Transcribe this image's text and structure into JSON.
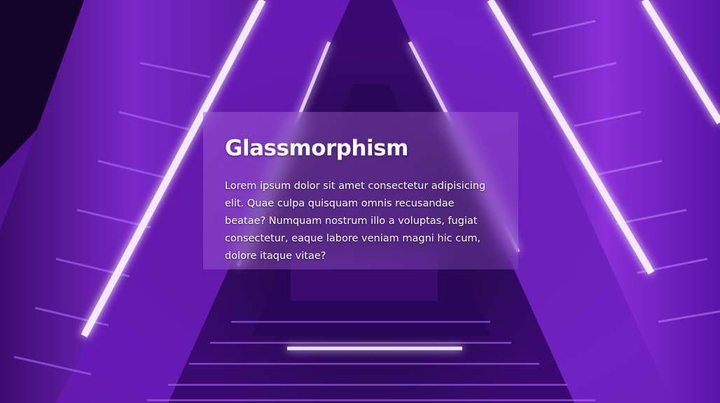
{
  "card": {
    "title": "Glassmorphism",
    "body": "Lorem ipsum dolor sit amet consectetur adipisicing elit. Quae culpa quisquam omnis recusandae beatae? Numquam nostrum illo a voluptas, fugiat consectetur, eaque labore veniam magni hic cum, dolore itaque vitae?"
  },
  "colors": {
    "background_dark": "#1a0630",
    "neon_purple": "#8a2be2",
    "neon_highlight": "#f2e6ff",
    "text": "#ffffff"
  },
  "background": {
    "description_icon": "neon-triangle-tunnel-image"
  }
}
